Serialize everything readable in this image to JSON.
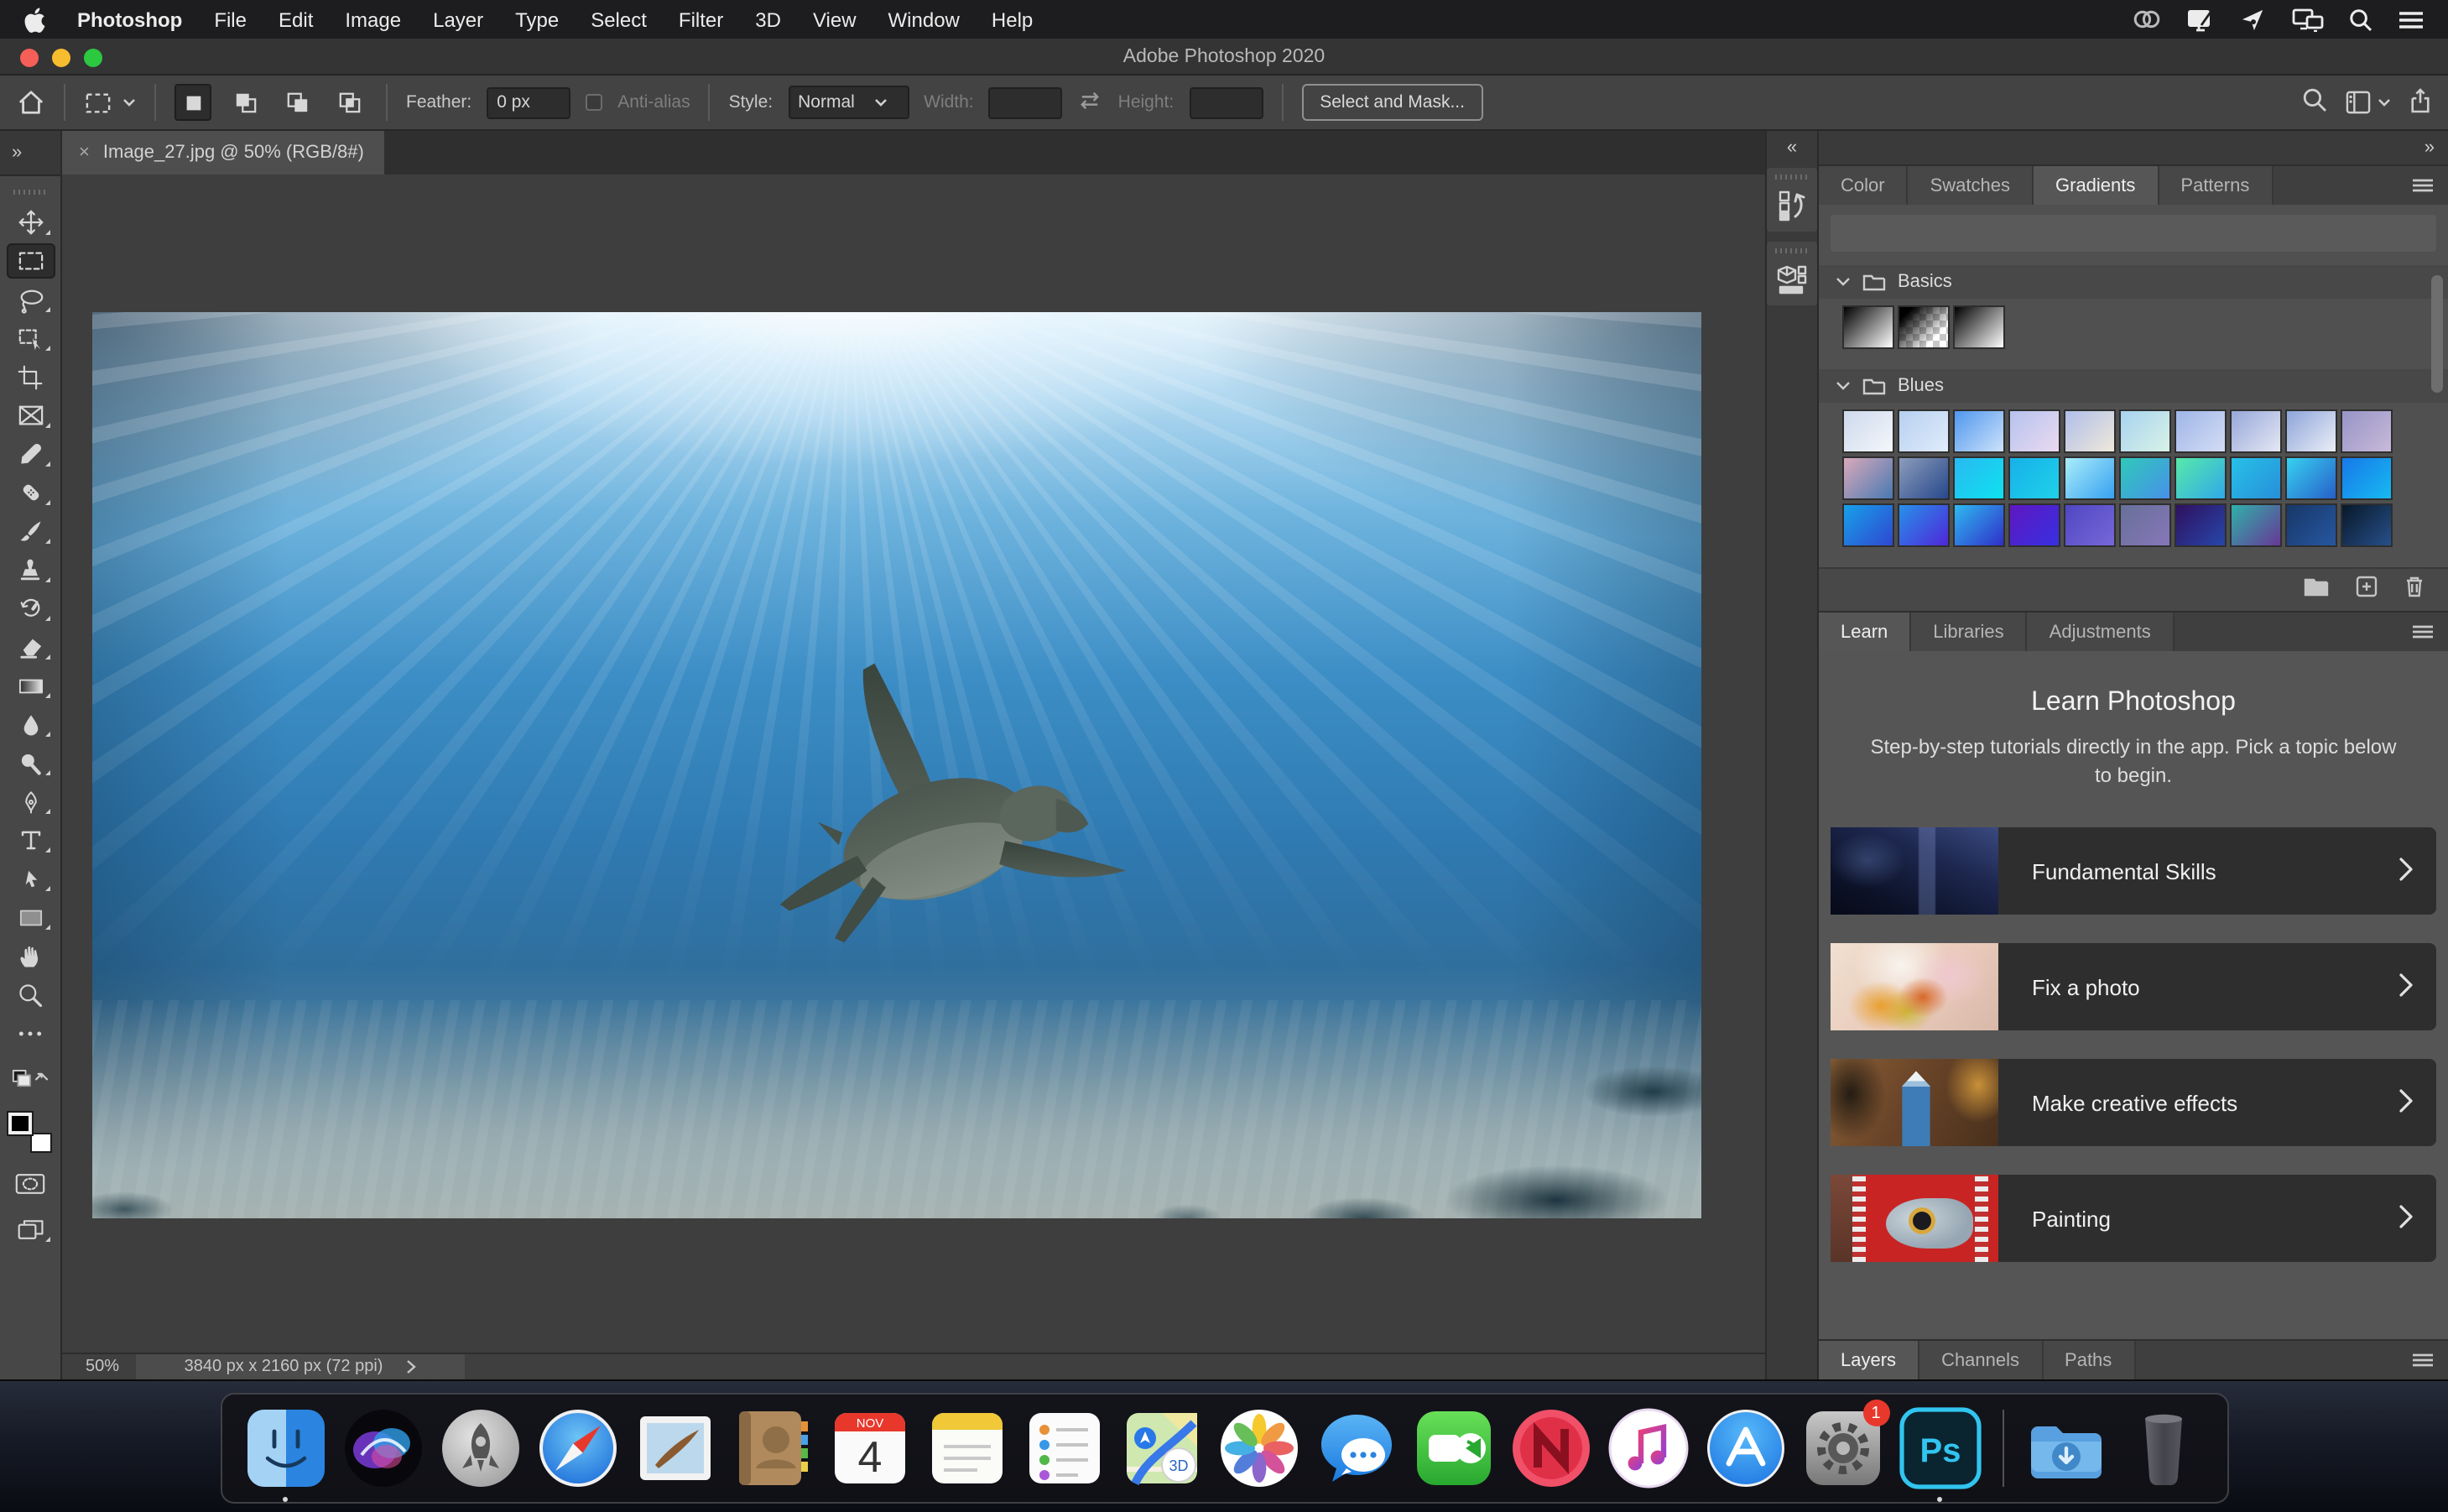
{
  "menu_bar": {
    "items": [
      "Photoshop",
      "File",
      "Edit",
      "Image",
      "Layer",
      "Type",
      "Select",
      "Filter",
      "3D",
      "View",
      "Window",
      "Help"
    ]
  },
  "title_bar": {
    "title": "Adobe Photoshop 2020"
  },
  "options_bar": {
    "feather_label": "Feather:",
    "feather_value": "0 px",
    "anti_alias_label": "Anti-alias",
    "style_label": "Style:",
    "style_value": "Normal",
    "width_label": "Width:",
    "width_value": "",
    "height_label": "Height:",
    "height_value": "",
    "select_and_mask_label": "Select and Mask..."
  },
  "document_tab": {
    "close": "×",
    "title": "Image_27.jpg @ 50% (RGB/8#)"
  },
  "status_bar": {
    "zoom": "50%",
    "info": "3840 px x 2160 px (72 ppi)"
  },
  "toolbar": {
    "expand": "»"
  },
  "panels": {
    "collapse_left": "«",
    "collapse_right": "»",
    "top_tabs": [
      "Color",
      "Swatches",
      "Gradients",
      "Patterns"
    ],
    "gradients": {
      "basics_label": "Basics",
      "blues_label": "Blues",
      "basics": [
        [
          "#000000",
          "#ffffff"
        ],
        "checker",
        [
          "#000000",
          "#ffffff"
        ]
      ],
      "blues_rows": [
        [
          [
            "#cdd9ec",
            "#f4f7fb"
          ],
          [
            "#b7d0f0",
            "#e0ecfb"
          ],
          [
            "#4f97ef",
            "#cde2fa"
          ],
          [
            "#b5c3ee",
            "#ead9f0"
          ],
          [
            "#b0bfe9",
            "#efe8da"
          ],
          [
            "#a8d3f0",
            "#d8f2e6"
          ],
          [
            "#9fb6e8",
            "#d4dcf4"
          ],
          [
            "#97a7da",
            "#e4e7f3"
          ],
          [
            "#8ea4da",
            "#eaeef6"
          ],
          [
            "#9794c6",
            "#c8bad9"
          ]
        ],
        [
          [
            "#d9a9ba",
            "#4979b2"
          ],
          [
            "#8c9cba",
            "#27488c"
          ],
          [
            "#29b9f1",
            "#0fe1ef"
          ],
          [
            "#17b1e9",
            "#1fd1e9"
          ],
          [
            "#a9edf9",
            "#37a1f1"
          ],
          [
            "#2fc9b9",
            "#4791e9"
          ],
          [
            "#57e9a9",
            "#2fa9e9"
          ],
          [
            "#27c1e9",
            "#278fd9"
          ],
          [
            "#37d1f1",
            "#275fc9"
          ],
          [
            "#1779e9",
            "#17b9f1"
          ]
        ],
        [
          [
            "#17a1e9",
            "#2f47d1"
          ],
          [
            "#2791e9",
            "#4f27d9"
          ],
          [
            "#2fb9f1",
            "#2f2fc9"
          ],
          [
            "#5f17c1",
            "#3730e1"
          ],
          [
            "#4f47c1",
            "#7767d9"
          ],
          [
            "#677099",
            "#8777b9"
          ],
          [
            "#2f1060",
            "#2747a9"
          ],
          [
            "#2fb1a9",
            "#673797"
          ],
          [
            "#173767",
            "#2757a1"
          ],
          [
            "#081829",
            "#27508a"
          ]
        ]
      ]
    },
    "learn": {
      "tabs": [
        "Learn",
        "Libraries",
        "Adjustments"
      ],
      "title": "Learn Photoshop",
      "subtitle": "Step-by-step tutorials directly in the app. Pick a topic below to begin.",
      "items": [
        "Fundamental Skills",
        "Fix a photo",
        "Make creative effects",
        "Painting"
      ]
    },
    "bottom_tabs": [
      "Layers",
      "Channels",
      "Paths"
    ]
  },
  "dock": {
    "calendar_month": "NOV",
    "calendar_day": "4",
    "settings_badge": "1",
    "ps_label": "Ps",
    "maps_badge": "3D"
  }
}
